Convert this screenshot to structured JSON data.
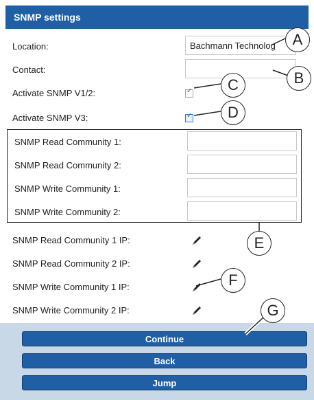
{
  "header": {
    "title": "SNMP settings"
  },
  "fields": {
    "location": {
      "label": "Location:",
      "value": "Bachmann Technolog"
    },
    "contact": {
      "label": "Contact:",
      "value": ""
    },
    "snmp_v12": {
      "label": "Activate SNMP V1/2:"
    },
    "snmp_v3": {
      "label": "Activate SNMP V3:"
    }
  },
  "communities": [
    {
      "label": "SNMP Read Community 1:"
    },
    {
      "label": "SNMP Read Community 2:"
    },
    {
      "label": "SNMP Write Community 1:"
    },
    {
      "label": "SNMP Write Community 2:"
    }
  ],
  "community_ips": [
    {
      "label": "SNMP Read Community 1 IP:",
      "icon": "pencil-icon"
    },
    {
      "label": "SNMP Read Community 2 IP:",
      "icon": "pencil-icon"
    },
    {
      "label": "SNMP Write Community 1 IP:",
      "icon": "pencil-icon"
    },
    {
      "label": "SNMP Write Community 2 IP:",
      "icon": "pencil-icon"
    }
  ],
  "buttons": {
    "continue": "Continue",
    "back": "Back",
    "jump": "Jump"
  },
  "callouts": {
    "a": "A",
    "b": "B",
    "c": "C",
    "d": "D",
    "e": "E",
    "f": "F",
    "g": "G"
  },
  "colors": {
    "header": "#1f5fa6",
    "button": "#1f5fa6",
    "panel": "#c9d8e6"
  }
}
